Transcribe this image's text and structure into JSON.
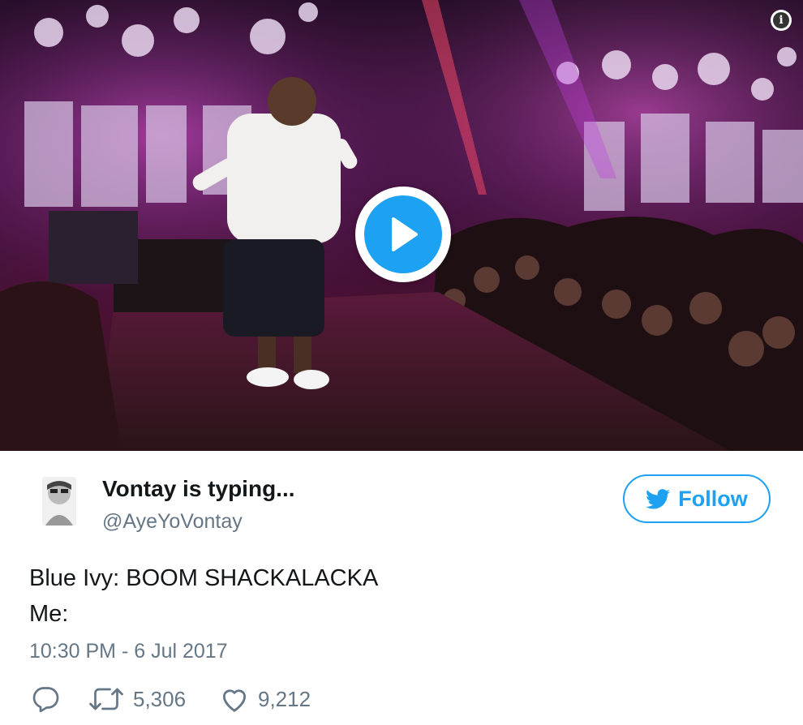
{
  "media": {
    "info_icon": "info-icon",
    "info_glyph": "i",
    "play_icon": "play-icon",
    "colors": {
      "play_button": "#1da1f2"
    }
  },
  "author": {
    "name": "Vontay is typing...",
    "handle": "@AyeYoVontay",
    "avatar_icon": "avatar"
  },
  "follow": {
    "label": "Follow",
    "icon": "twitter-bird-icon",
    "color": "#1da1f2"
  },
  "tweet": {
    "lines": [
      "Blue Ivy: BOOM SHACKALACKA",
      "Me:"
    ],
    "timestamp": "10:30 PM - 6 Jul 2017"
  },
  "actions": {
    "reply": {
      "icon": "reply-icon"
    },
    "retweet": {
      "icon": "retweet-icon",
      "count": "5,306"
    },
    "like": {
      "icon": "heart-icon",
      "count": "9,212"
    }
  }
}
